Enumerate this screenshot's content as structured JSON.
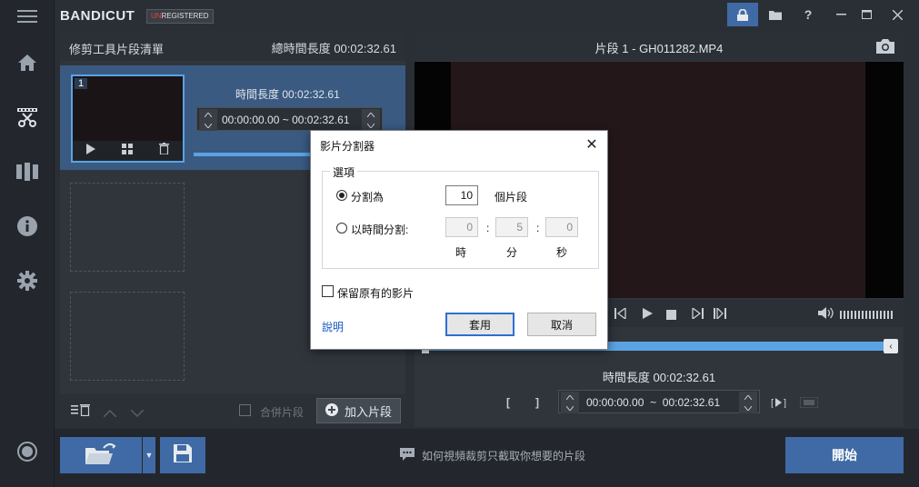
{
  "app": {
    "brand_main": "BANDI",
    "brand_cut": "CUT",
    "badge_un": "UN",
    "badge_rest": "REGISTERED"
  },
  "icons": {
    "hamburger": "menu-icon",
    "home": "home-icon",
    "cut": "scissors-icon",
    "film": "film-icon",
    "info": "info-icon",
    "settings": "gear-icon",
    "record": "record-icon",
    "lock": "lock-icon",
    "folder": "folder-icon",
    "help": "help-icon"
  },
  "clip_panel": {
    "title": "修剪工具片段清單",
    "total_label": "總時間長度",
    "total_value": "00:02:32.61",
    "clip_number": "1",
    "clip_duration_label": "時間長度",
    "clip_duration_value": "00:02:32.61",
    "clip_start": "00:00:00.00",
    "clip_sep": "~",
    "clip_end": "00:02:32.61",
    "merge_label": "合併片段",
    "add_label": "加入片段"
  },
  "video_panel": {
    "title": "片段 1 - GH011282.MP4",
    "duration_label": "時間長度",
    "duration_value": "00:02:32.61",
    "start": "00:00:00.00",
    "sep": "~",
    "end": "00:02:32.61"
  },
  "bottom": {
    "hint": "如何視頻裁剪只截取你想要的片段",
    "start_label": "開始"
  },
  "dialog": {
    "title": "影片分割器",
    "group_label": "選項",
    "opt_count_label": "分割為",
    "count_value": "10",
    "count_unit": "個片段",
    "opt_time_label": "以時間分割:",
    "hours_value": "0",
    "minutes_value": "5",
    "seconds_value": "0",
    "colon": ":",
    "unit_h": "時",
    "unit_m": "分",
    "unit_s": "秒",
    "keep_label": "保留原有的影片",
    "help_label": "說明",
    "apply_label": "套用",
    "cancel_label": "取消"
  },
  "colors": {
    "accent": "#3f6aa5",
    "selection": "#5ba3e3",
    "badge_red": "#e0463e"
  }
}
